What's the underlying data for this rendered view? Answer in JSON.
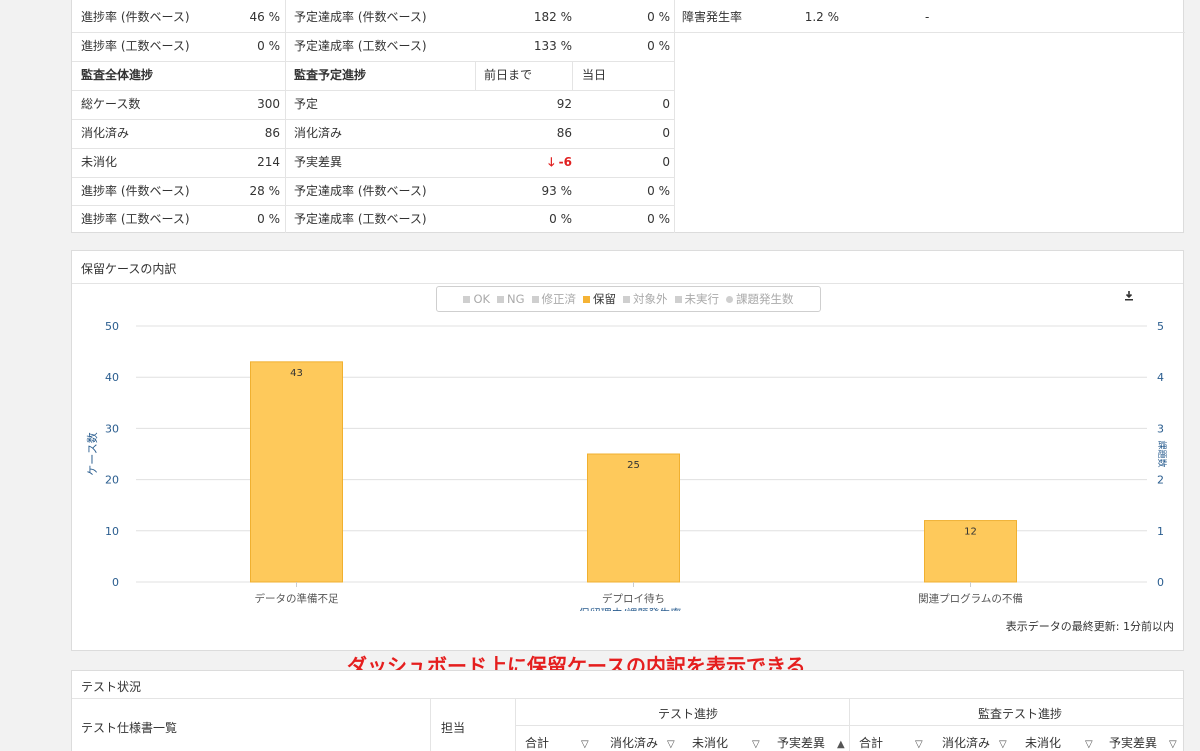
{
  "summary": {
    "row_a_left_label": "進捗率 (件数ベース)",
    "row_a_left_value": "46 %",
    "row_a_mid_label": "予定達成率 (件数ベース)",
    "row_a_mid_v1": "182 %",
    "row_a_mid_v2": "0 %",
    "row_a_right_label": "障害発生率",
    "row_a_right_v1": "1.2 %",
    "row_a_right_v2": "-",
    "row_b_left_label": "進捗率 (工数ベース)",
    "row_b_left_value": "0 %",
    "row_b_mid_label": "予定達成率 (工数ベース)",
    "row_b_mid_v1": "133 %",
    "row_b_mid_v2": "0 %",
    "audit_overall_title": "監査全体進捗",
    "audit_plan_title": "監査予定進捗",
    "col_prev": "前日まで",
    "col_today": "当日",
    "left_rows": [
      {
        "label": "総ケース数",
        "value": "300"
      },
      {
        "label": "消化済み",
        "value": "86"
      },
      {
        "label": "未消化",
        "value": "214"
      },
      {
        "label": "進捗率 (件数ベース)",
        "value": "28 %"
      },
      {
        "label": "進捗率 (工数ベース)",
        "value": "0 %"
      }
    ],
    "mid_rows": [
      {
        "label": "予定",
        "prev": "92",
        "today": "0"
      },
      {
        "label": "消化済み",
        "prev": "86",
        "today": "0"
      },
      {
        "label": "予実差異",
        "prev": "-6",
        "today": "0"
      },
      {
        "label": "予定達成率 (件数ベース)",
        "prev": "93 %",
        "today": "0 %"
      },
      {
        "label": "予定達成率 (工数ベース)",
        "prev": "0 %",
        "today": "0 %"
      }
    ]
  },
  "chart_panel": {
    "title": "保留ケースの内訳",
    "legend": [
      {
        "label": "OK",
        "active": false,
        "shape": "square"
      },
      {
        "label": "NG",
        "active": false,
        "shape": "square"
      },
      {
        "label": "修正済",
        "active": false,
        "shape": "square"
      },
      {
        "label": "保留",
        "active": true,
        "shape": "square"
      },
      {
        "label": "対象外",
        "active": false,
        "shape": "square"
      },
      {
        "label": "未実行",
        "active": false,
        "shape": "square"
      },
      {
        "label": "課題発生数",
        "active": false,
        "shape": "circle"
      }
    ],
    "footnote": "表示データの最終更新: 1分前以内"
  },
  "chart_data": {
    "type": "bar",
    "categories": [
      "データの準備不足",
      "デプロイ待ち",
      "関連プログラムの不備"
    ],
    "series": [
      {
        "name": "保留",
        "values": [
          43,
          25,
          12
        ],
        "color": "#fec95b"
      }
    ],
    "xlabel": "保留理由/課題発生率",
    "ylabel": "ケース数",
    "y2label": "課題数",
    "ylim": [
      0,
      50
    ],
    "y2lim": [
      0,
      5
    ],
    "yticks": [
      0,
      10,
      20,
      30,
      40,
      50
    ],
    "y2ticks": [
      0,
      1,
      2,
      3,
      4,
      5
    ],
    "grid": true
  },
  "caption": "ダッシュボード上に保留ケースの内訳を表示できる",
  "test_status": {
    "title": "テスト状況",
    "spec_list": "テスト仕様書一覧",
    "assignee": "担当",
    "group1": "テスト進捗",
    "group2": "監査テスト進捗",
    "cols": [
      "合計",
      "消化済み",
      "未消化",
      "予実差異",
      "合計",
      "消化済み",
      "未消化",
      "予実差異"
    ]
  },
  "colors": {
    "bar": "#fec95b",
    "bar_border": "#f0b030",
    "axis_text": "#2a5d8f",
    "caption": "#e51e1e",
    "negative": "#e02020"
  }
}
